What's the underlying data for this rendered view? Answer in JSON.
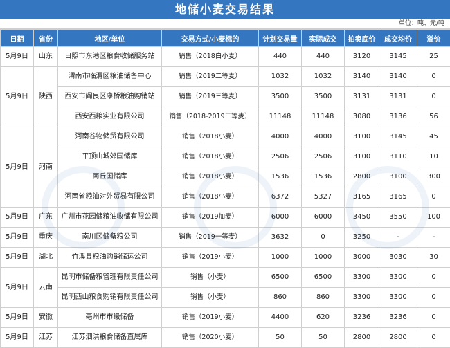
{
  "title": "地储小麦交易结果",
  "unit": "单位：吨、元/吨",
  "headers": [
    "日期",
    "省份",
    "地区/单位",
    "交易方式/小麦标的",
    "计划交易量",
    "实际成交",
    "拍卖底价",
    "成交均价",
    "溢价"
  ],
  "groups": [
    {
      "date": "5月9日",
      "province": "山东",
      "rows": [
        {
          "unit": "日照市东港区粮食收储服务站",
          "method": "销售（2018白小麦）",
          "plan": "440",
          "actual": "440",
          "floor": "3120",
          "avg": "3145",
          "premium": "25"
        }
      ]
    },
    {
      "date": "5月9日",
      "province": "陕西",
      "rows": [
        {
          "unit": "渭南市临渭区粮油储备中心",
          "method": "销售（2019二等麦）",
          "plan": "1032",
          "actual": "1032",
          "floor": "3140",
          "avg": "3140",
          "premium": "0"
        },
        {
          "unit": "西安市阎良区康桥粮油购销站",
          "method": "销售（2019三等麦）",
          "plan": "3500",
          "actual": "3500",
          "floor": "3131",
          "avg": "3131",
          "premium": "0"
        },
        {
          "unit": "西安西粮实业有限公司",
          "method": "销售（2018-2019三等麦）",
          "plan": "11148",
          "actual": "11148",
          "floor": "3080",
          "avg": "3136",
          "premium": "56"
        }
      ]
    },
    {
      "date": "5月9日",
      "province": "河南",
      "rows": [
        {
          "unit": "河南谷物储贸有限公司",
          "method": "销售（2018小麦）",
          "plan": "4000",
          "actual": "4000",
          "floor": "3100",
          "avg": "3145",
          "premium": "45"
        },
        {
          "unit": "平顶山城郊国储库",
          "method": "销售（2018小麦）",
          "plan": "2506",
          "actual": "2506",
          "floor": "3100",
          "avg": "3110",
          "premium": "10"
        },
        {
          "unit": "商丘国储库",
          "method": "销售（2018小麦）",
          "plan": "1536",
          "actual": "1536",
          "floor": "2800",
          "avg": "3100",
          "premium": "300"
        },
        {
          "unit": "河南省粮油对外贸易有限公司",
          "method": "销售（2018小麦）",
          "plan": "6372",
          "actual": "5327",
          "floor": "3165",
          "avg": "3165",
          "premium": "0"
        }
      ]
    },
    {
      "date": "5月9日",
      "province": "广东",
      "rows": [
        {
          "unit": "广州市花园储粮油收储有限公司",
          "method": "销售（2019加麦）",
          "plan": "6000",
          "actual": "6000",
          "floor": "3450",
          "avg": "3550",
          "premium": "100"
        }
      ]
    },
    {
      "date": "5月9日",
      "province": "重庆",
      "rows": [
        {
          "unit": "南川区储备粮公司",
          "method": "销售（2019一等麦）",
          "plan": "3632",
          "actual": "0",
          "floor": "3250",
          "avg": "-",
          "premium": "-"
        }
      ]
    },
    {
      "date": "5月9日",
      "province": "湖北",
      "rows": [
        {
          "unit": "竹溪县粮油购销储运公司",
          "method": "销售（2019小麦）",
          "plan": "1000",
          "actual": "1000",
          "floor": "3000",
          "avg": "3030",
          "premium": "30"
        }
      ]
    },
    {
      "date": "5月9日",
      "province": "云南",
      "rows": [
        {
          "unit": "昆明市储备粮管理有限责任公司",
          "method": "销售（小麦）",
          "plan": "6500",
          "actual": "6500",
          "floor": "3300",
          "avg": "3300",
          "premium": "0"
        },
        {
          "unit": "昆明西山粮食购销有限责任公司",
          "method": "销售（小麦）",
          "plan": "860",
          "actual": "860",
          "floor": "3300",
          "avg": "3300",
          "premium": "0"
        }
      ]
    },
    {
      "date": "5月9日",
      "province": "安徽",
      "rows": [
        {
          "unit": "亳州市市级储备",
          "method": "销售（2019小麦）",
          "plan": "4400",
          "actual": "620",
          "floor": "3236",
          "avg": "3236",
          "premium": "0"
        }
      ]
    },
    {
      "date": "5月9日",
      "province": "江苏",
      "rows": [
        {
          "unit": "江苏泗洪粮食储备直属库",
          "method": "销售（2020小麦）",
          "plan": "50",
          "actual": "50",
          "floor": "2800",
          "avg": "2800",
          "premium": "0"
        }
      ]
    }
  ]
}
